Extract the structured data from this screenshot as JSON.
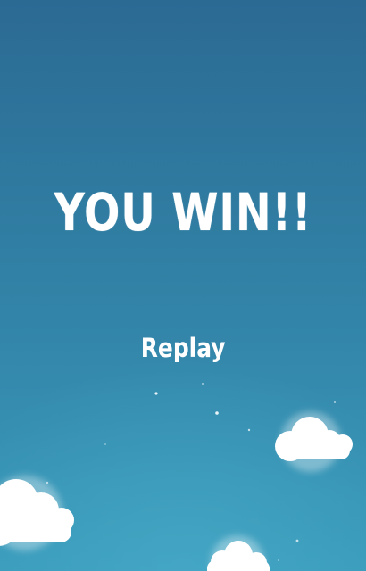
{
  "screen": {
    "title": "YOU WIN!!",
    "replay_label": "Replay"
  },
  "colors": {
    "sky_top": "#2b6d95",
    "sky_bottom": "#3a99b8",
    "text": "#ffffff",
    "cloud": "#ffffff"
  },
  "icons": [
    "cloud-icon",
    "star-icon"
  ]
}
